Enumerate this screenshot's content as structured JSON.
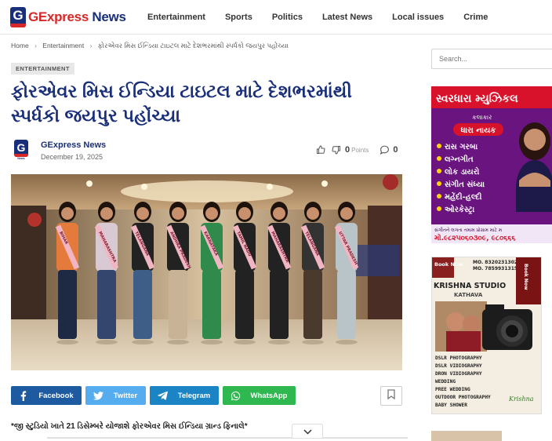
{
  "site": {
    "logo_letter": "G",
    "logo_part1": "GExpress",
    "logo_part2": "News",
    "brand_red": "#d62828",
    "brand_blue": "#1a2f7a"
  },
  "nav": {
    "items": [
      "Entertainment",
      "Sports",
      "Politics",
      "Latest News",
      "Local issues",
      "Crime"
    ]
  },
  "breadcrumb": {
    "items": [
      "Home",
      "Entertainment",
      "ફોરએવર મિસ ઈન્ડિયા ટાઇટલ માટે દેશભરમાંથી સ્પર્ધકો જયપુર પહોંચ્યા"
    ]
  },
  "article": {
    "category": "ENTERTAINMENT",
    "title": "ફોરએવર મિસ ઈન્ડિયા ટાઇટલ માટે દેશભરમાંથી સ્પર્ધકો જયપુર પહોંચ્યા",
    "author": "GExpress News",
    "date": "December 19, 2025",
    "points": "0",
    "points_label": "Points",
    "comments": "0",
    "subheading": "*જી સ્ટુડિયો ખાતે 21 ડિસેમ્બરે યોજાશે ફોરએવર મિસ ઈન્ડિયા ગ્રાન્ડ ફિનાલે*",
    "image_sashes": [
      "BIHAR",
      "MAHARASHTRA",
      "TELANGANA",
      "ANDHRA PRADESH",
      "KARNATAKA",
      "TAMIL NADU",
      "MAHARASHTRA",
      "TELANGANA",
      "UTTAR PRADESH"
    ]
  },
  "share": {
    "facebook": "Facebook",
    "twitter": "Twitter",
    "telegram": "Telegram",
    "whatsapp": "WhatsApp"
  },
  "sidebar": {
    "search_placeholder": "Search...",
    "ad1": {
      "title": "સ્વરધારા મ્યુઝિકલ",
      "subtitle": "કલાકાર",
      "artist": "ધારા નાયક",
      "items": [
        "રાસ ગરબા",
        "લગ્નગીત",
        "લોક ડાયરો",
        "સંગીત સંધ્યા",
        "મહેંદી-હલ્દી",
        "ઓરકેસ્ટ્રા"
      ],
      "note": "સંગીતને લગતા તમામ પ્રોગ્રામ માટે મ",
      "phone": "મો.૯૮૨૫૦૬૦૩૦૯, ૯૮૦૬૬૬"
    },
    "ad2": {
      "book_now": "Book Now",
      "phones": [
        "MO. 8320231302",
        "MO. 7859931315"
      ],
      "studio": "KRISHNA STUDIO",
      "location": "KATHAVA",
      "services": [
        "DSLR PHOTOGRAPHY",
        "DSLR VIDIOGRAPHY",
        "DRON VIDIOGRAPHY",
        "WEDDING",
        "PREE WEDDING",
        "OUTDOOR PHOTOGRAPHY",
        "BABY SHOWER"
      ],
      "logo_text": "Krishna"
    }
  }
}
